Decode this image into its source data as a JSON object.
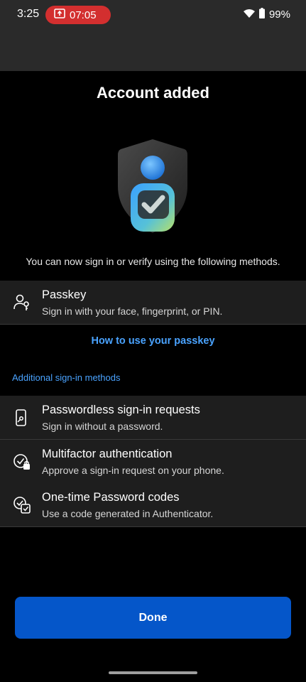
{
  "status_bar": {
    "time": "3:25",
    "recording_time": "07:05",
    "battery": "99%",
    "icons": [
      "screen-record-icon",
      "wifi-icon",
      "battery-icon"
    ]
  },
  "page": {
    "title": "Account added",
    "intro": "You can now sign in or verify using the following methods."
  },
  "passkey": {
    "icon": "passkey-icon",
    "title": "Passkey",
    "subtitle": "Sign in with your face, fingerprint, or PIN."
  },
  "passkey_link": "How to use your passkey",
  "additional": {
    "label": "Additional sign-in methods",
    "items": [
      {
        "icon": "phone-key-icon",
        "title": "Passwordless sign-in requests",
        "subtitle": "Sign in without a password."
      },
      {
        "icon": "shield-lock-icon",
        "title": "Multifactor authentication",
        "subtitle": "Approve a sign-in request on your phone."
      },
      {
        "icon": "code-check-icon",
        "title": "One-time Password codes",
        "subtitle": "Use a code generated in Authenticator."
      }
    ]
  },
  "done_label": "Done",
  "colors": {
    "accent": "#0556c9",
    "link": "#4aa3ff",
    "recording": "#d32f2f",
    "row_bg": "#1e1e1e"
  }
}
